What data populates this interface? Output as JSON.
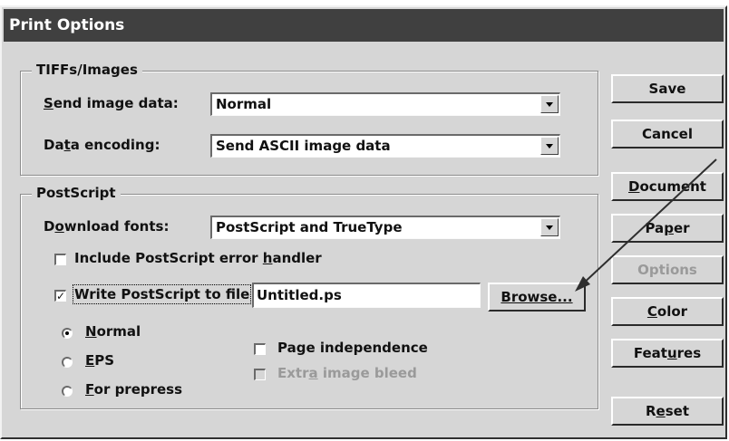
{
  "window": {
    "title": "Print Options"
  },
  "tiffs": {
    "title": "TIFFs/Images",
    "send_image_label_pre": "",
    "send_image_label_u": "S",
    "send_image_label_post": "end image data:",
    "send_image_value": "Normal",
    "encoding_label_pre": "Da",
    "encoding_label_u": "t",
    "encoding_label_post": "a encoding:",
    "encoding_value": "Send ASCII image data"
  },
  "postscript": {
    "title": "PostScript",
    "download_label_pre": "D",
    "download_label_u": "o",
    "download_label_post": "wnload fonts:",
    "download_value": "PostScript and TrueType",
    "error_handler_pre": "Include PostScript error ",
    "error_handler_u": "h",
    "error_handler_post": "andler",
    "error_handler_checked": "",
    "write_ps_label": "Write PostScript to file",
    "write_ps_checked": "✓",
    "filename": "Untitled.ps",
    "browse_label": "Browse...",
    "radio_normal_u": "N",
    "radio_normal_post": "ormal",
    "radio_eps_u": "E",
    "radio_eps_post": "PS",
    "radio_prepress_u": "F",
    "radio_prepress_post": "or prepress",
    "page_independence": "Page independence",
    "extra_bleed_pre": "Extr",
    "extra_bleed_u": "a",
    "extra_bleed_post": " image bleed"
  },
  "buttons": {
    "save": "Save",
    "cancel": "Cancel",
    "document_u": "D",
    "document_post": "ocument",
    "paper_pre": "Pa",
    "paper_u": "p",
    "paper_post": "er",
    "options": "Options",
    "color_u": "C",
    "color_post": "olor",
    "features_pre": "Feat",
    "features_u": "u",
    "features_post": "res",
    "reset_pre": "R",
    "reset_u": "e",
    "reset_post": "set"
  },
  "colors": {
    "dialog_bg": "#d6d6d6",
    "titlebar_bg": "#404040",
    "titlebar_text": "#ffffff",
    "disabled_text": "#9a9a9a"
  },
  "icons": {
    "combo_arrow": "chevron-down-icon",
    "checkmark": "check-icon",
    "annotation": "arrow-pointer-icon"
  }
}
